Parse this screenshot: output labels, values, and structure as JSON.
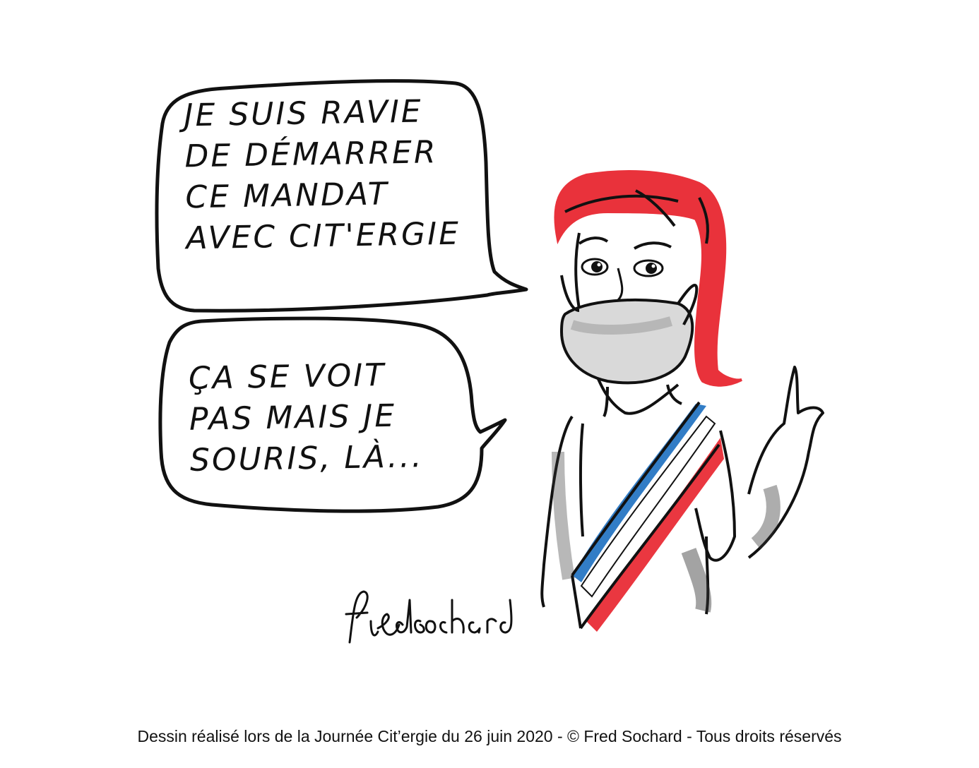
{
  "bubble_top": {
    "lines": [
      "JE SUIS RAVIE",
      "DE DÉMARRER",
      "CE MANDAT",
      "AVEC CIT'ERGIE"
    ]
  },
  "bubble_bottom": {
    "lines": [
      "ÇA SE VOIT",
      "PAS MAIS JE",
      "SOURIS, LÀ..."
    ]
  },
  "signature": "fredsochard",
  "caption": "Dessin réalisé lors de la Journée Cit’ergie du 26 juin 2020 - © Fred Sochard - Tous droits réservés",
  "colors": {
    "hair": "#e8212b",
    "sash_blue": "#1c6fc0",
    "sash_red": "#e8212b",
    "ink": "#111111",
    "shading": "#333333"
  }
}
